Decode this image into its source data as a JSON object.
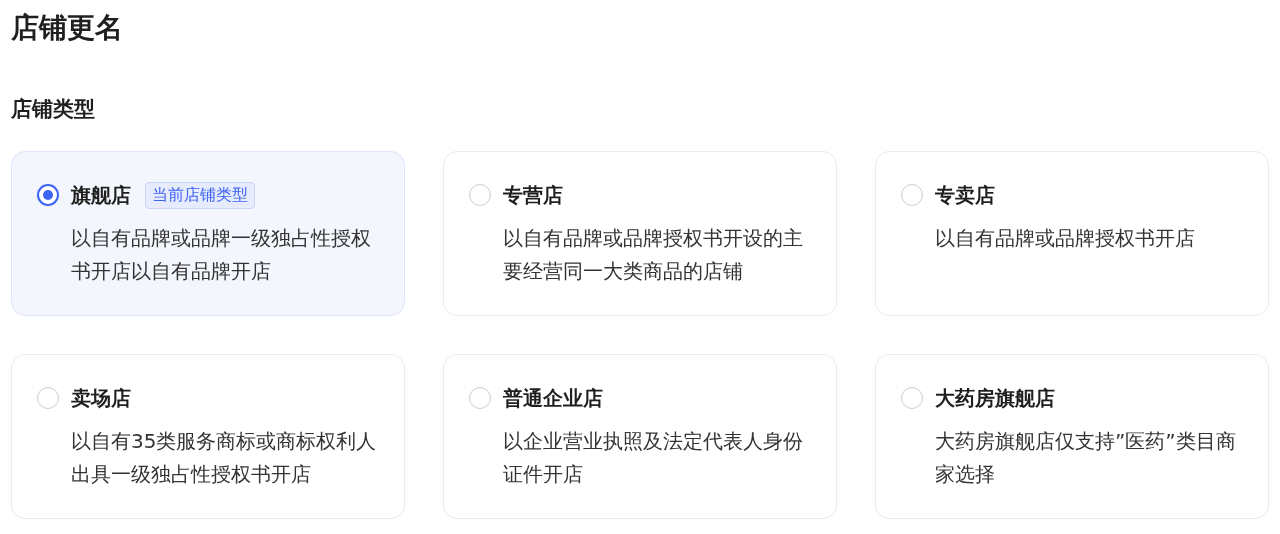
{
  "page_title": "店铺更名",
  "section_title": "店铺类型",
  "options": [
    {
      "name": "旗舰店",
      "badge": "当前店铺类型",
      "description": "以自有品牌或品牌一级独占性授权书开店以自有品牌开店",
      "selected": true
    },
    {
      "name": "专营店",
      "description": "以自有品牌或品牌授权书开设的主要经营同一大类商品的店铺",
      "selected": false
    },
    {
      "name": "专卖店",
      "description": "以自有品牌或品牌授权书开店",
      "selected": false
    },
    {
      "name": "卖场店",
      "description": "以自有35类服务商标或商标权利人出具一级独占性授权书开店",
      "selected": false
    },
    {
      "name": "普通企业店",
      "description": "以企业营业执照及法定代表人身份证件开店",
      "selected": false
    },
    {
      "name": "大药房旗舰店",
      "description": "大药房旗舰店仅支持”医药”类目商家选择",
      "selected": false
    }
  ]
}
